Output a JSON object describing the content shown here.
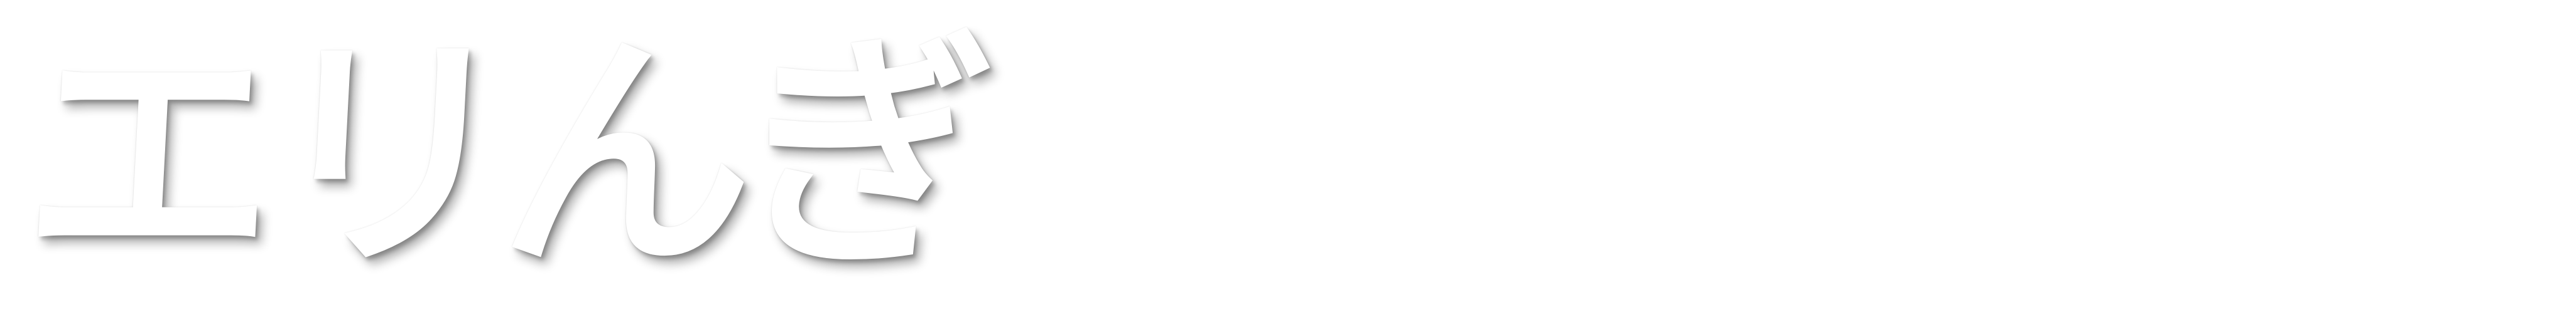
{
  "logo": {
    "text": "エリんぎ",
    "fill_color": "#ffffff",
    "shadow_color": "#00000052",
    "background": "#ffffff"
  }
}
